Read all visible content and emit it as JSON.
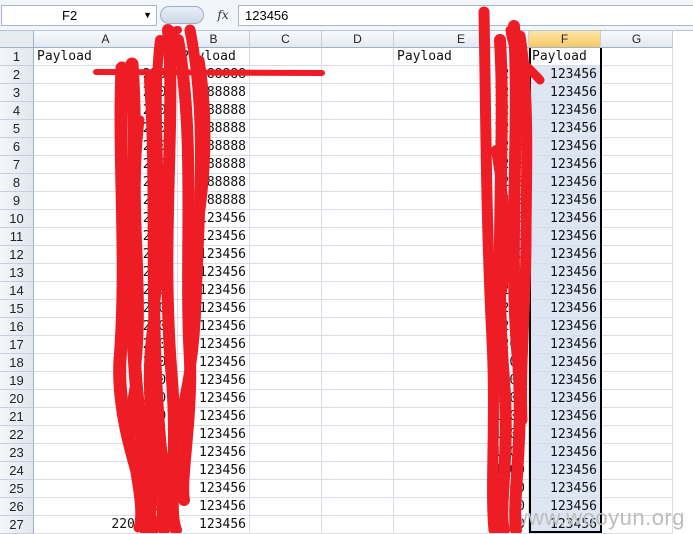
{
  "formula_bar": {
    "name_box": "F2",
    "dropdown_glyph": "▼",
    "fx_label": "fx",
    "value": "123456"
  },
  "columns": [
    "A",
    "B",
    "C",
    "D",
    "E",
    "F",
    "G"
  ],
  "selected_column": "F",
  "rows": [
    1,
    2,
    3,
    4,
    5,
    6,
    7,
    8,
    9,
    10,
    11,
    12,
    13,
    14,
    15,
    16,
    17,
    18,
    19,
    20,
    21,
    22,
    23,
    24,
    25,
    26,
    27
  ],
  "row1": {
    "A": "Payload",
    "B": "Payload",
    "E": "Payload",
    "F": "Payload"
  },
  "colA": [
    "",
    "2201",
    "2201",
    "2201",
    "2201",
    "2201",
    "2201",
    "2201",
    "2201",
    "2201",
    "2201",
    "2201",
    "2201",
    "2201",
    "2201",
    "2201",
    "2201",
    "2201",
    "2201",
    "2201",
    "2201",
    "2201",
    "2201",
    "2201",
    "2201",
    "2201",
    "22010059"
  ],
  "colB": [
    "",
    "888888",
    "88888",
    "88888",
    "88888",
    "88888",
    "88888",
    "88888",
    "88888",
    "123456",
    "123456",
    "123456",
    "123456",
    "123456",
    "123456",
    "123456",
    "123456",
    "123456",
    "123456",
    "123456",
    "123456",
    "123456",
    "123456",
    "123456",
    "123456",
    "123456",
    "123456"
  ],
  "colE": [
    "",
    "1200",
    "1200",
    "1200",
    "1200",
    "1200",
    "1200",
    "1200",
    "1200",
    "1200",
    "1200",
    "1200",
    "1200",
    "1200",
    "1200",
    "1200",
    "1200",
    "1200",
    "1200",
    "1200",
    "1200",
    "1200",
    "1200",
    "1200",
    "1200",
    "1200",
    "1200"
  ],
  "colF": [
    "",
    "123456",
    "123456",
    "123456",
    "123456",
    "123456",
    "123456",
    "123456",
    "123456",
    "123456",
    "123456",
    "123456",
    "123456",
    "123456",
    "123456",
    "123456",
    "123456",
    "123456",
    "123456",
    "123456",
    "123456",
    "123456",
    "123456",
    "123456",
    "123456",
    "123456",
    "123456"
  ],
  "watermark": "www.wooyun.org",
  "scribble_color": "#ee1c24"
}
